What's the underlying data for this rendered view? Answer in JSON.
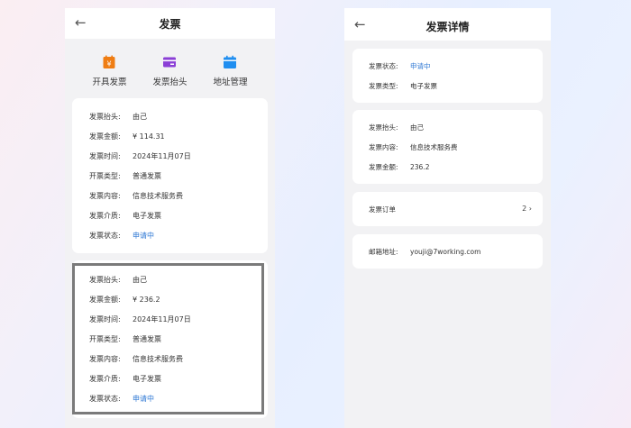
{
  "left": {
    "back_glyph": "←",
    "title": "发票",
    "quick_actions": [
      {
        "label": "开具发票",
        "icon": "yen-receipt-icon",
        "color": "#ef7d13"
      },
      {
        "label": "发票抬头",
        "icon": "card-icon",
        "color": "#8b3fd6"
      },
      {
        "label": "地址管理",
        "icon": "calendar-icon",
        "color": "#1f8ef0"
      }
    ],
    "invoices": [
      {
        "rows": [
          {
            "label": "发票抬头:",
            "value": "由己"
          },
          {
            "label": "发票金额:",
            "value": "¥ 114.31"
          },
          {
            "label": "发票时间:",
            "value": "2024年11月07日"
          },
          {
            "label": "开票类型:",
            "value": "普通发票"
          },
          {
            "label": "发票内容:",
            "value": "信息技术服务费"
          },
          {
            "label": "发票介质:",
            "value": "电子发票"
          },
          {
            "label": "发票状态:",
            "value": "申请中"
          }
        ]
      },
      {
        "rows": [
          {
            "label": "发票抬头:",
            "value": "由己"
          },
          {
            "label": "发票金额:",
            "value": "¥ 236.2"
          },
          {
            "label": "发票时间:",
            "value": "2024年11月07日"
          },
          {
            "label": "开票类型:",
            "value": "普通发票"
          },
          {
            "label": "发票内容:",
            "value": "信息技术服务费"
          },
          {
            "label": "发票介质:",
            "value": "电子发票"
          },
          {
            "label": "发票状态:",
            "value": "申请中"
          }
        ]
      }
    ]
  },
  "right": {
    "back_glyph": "←",
    "title": "发票详情",
    "status_card": {
      "status_label": "发票状态:",
      "status_value": "申请中",
      "type_label": "发票类型:",
      "type_value": "电子发票"
    },
    "info_card": {
      "title_label": "发票抬头:",
      "title_value": "由己",
      "content_label": "发票内容:",
      "content_value": "信息技术服务费",
      "amount_label": "发票金额:",
      "amount_value": "236.2"
    },
    "order_card": {
      "label": "发票订单",
      "count": "2",
      "chevron": "›"
    },
    "email_card": {
      "label": "邮箱地址:",
      "value": "youji@7working.com"
    }
  },
  "colors": {
    "status_blue": "#2f78d4",
    "highlight_border": "#7a7a7a"
  }
}
